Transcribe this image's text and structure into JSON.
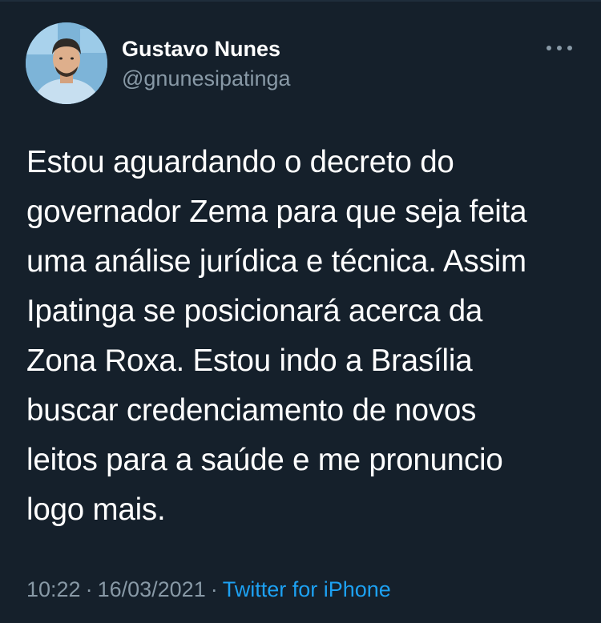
{
  "tweet": {
    "author": {
      "name": "Gustavo Nunes",
      "handle": "@gnunesipatinga"
    },
    "text": "Estou aguardando o decreto do\ngovernador Zema para que seja feita\numa análise jurídica e técnica. Assim\nIpatinga se posicionará acerca da\nZona Roxa. Estou indo a Brasília\nbuscar credenciamento de novos\nleitos para a saúde e me pronuncio\nlogo mais.",
    "time": "10:22",
    "date": "16/03/2021",
    "separator": "·",
    "source": "Twitter for iPhone",
    "more_icon": "more-horizontal-icon"
  },
  "colors": {
    "background": "#15202b",
    "text": "#ffffff",
    "secondary_text": "#8899a6",
    "link": "#1da1f2"
  }
}
